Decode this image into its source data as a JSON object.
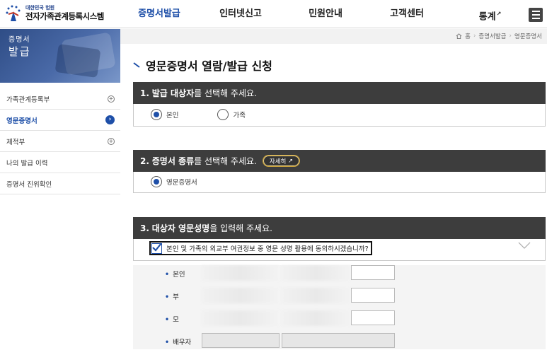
{
  "header": {
    "logo_sub": "대한민국 법원",
    "logo_main": "전자가족관계등록시스템",
    "nav": [
      {
        "label": "증명서발급",
        "active": true
      },
      {
        "label": "인터넷신고",
        "active": false
      },
      {
        "label": "민원안내",
        "active": false
      },
      {
        "label": "고객센터",
        "active": false
      },
      {
        "label": "통계",
        "active": false,
        "external": true
      }
    ],
    "menu_icon": "hamburger-menu-icon"
  },
  "banner": {
    "line1": "증명서",
    "line2": "발급"
  },
  "sidebar": {
    "items": [
      {
        "label": "가족관계등록부",
        "icon": "⊕"
      },
      {
        "label": "영문증명서",
        "icon": "›",
        "active": true
      },
      {
        "label": "제적부",
        "icon": "⊕"
      },
      {
        "label": "나의 발급 이력",
        "icon": ""
      },
      {
        "label": "증명서 진위확인",
        "icon": ""
      }
    ]
  },
  "breadcrumb": [
    "홈",
    "증명서발급",
    "영문증명서"
  ],
  "page_title": "영문증명서 열람/발급 신청",
  "section1": {
    "num": "1.",
    "bold": "발급 대상자",
    "rest": "를 선택해 주세요.",
    "options": [
      {
        "label": "본인",
        "checked": true
      },
      {
        "label": "가족",
        "checked": false
      }
    ]
  },
  "section2": {
    "num": "2.",
    "bold": "증명서 종류",
    "rest": "를 선택해 주세요.",
    "detail_button": "자세히",
    "options": [
      {
        "label": "영문증명서",
        "checked": true
      }
    ]
  },
  "section3": {
    "num": "3.",
    "bold": "대상자 영문성명",
    "rest": "을 입력해 주세요.",
    "consent": "본인 및 가족의 외교부 여권정보 중 영문 성명 활용에 동의하시겠습니까?",
    "rows": [
      {
        "label": "본인"
      },
      {
        "label": "부"
      },
      {
        "label": "모"
      },
      {
        "label": "배우자"
      }
    ]
  },
  "colors": {
    "accent": "#1e4fa8",
    "section_header": "#3d3d3d",
    "banner": "#2f4d86"
  }
}
